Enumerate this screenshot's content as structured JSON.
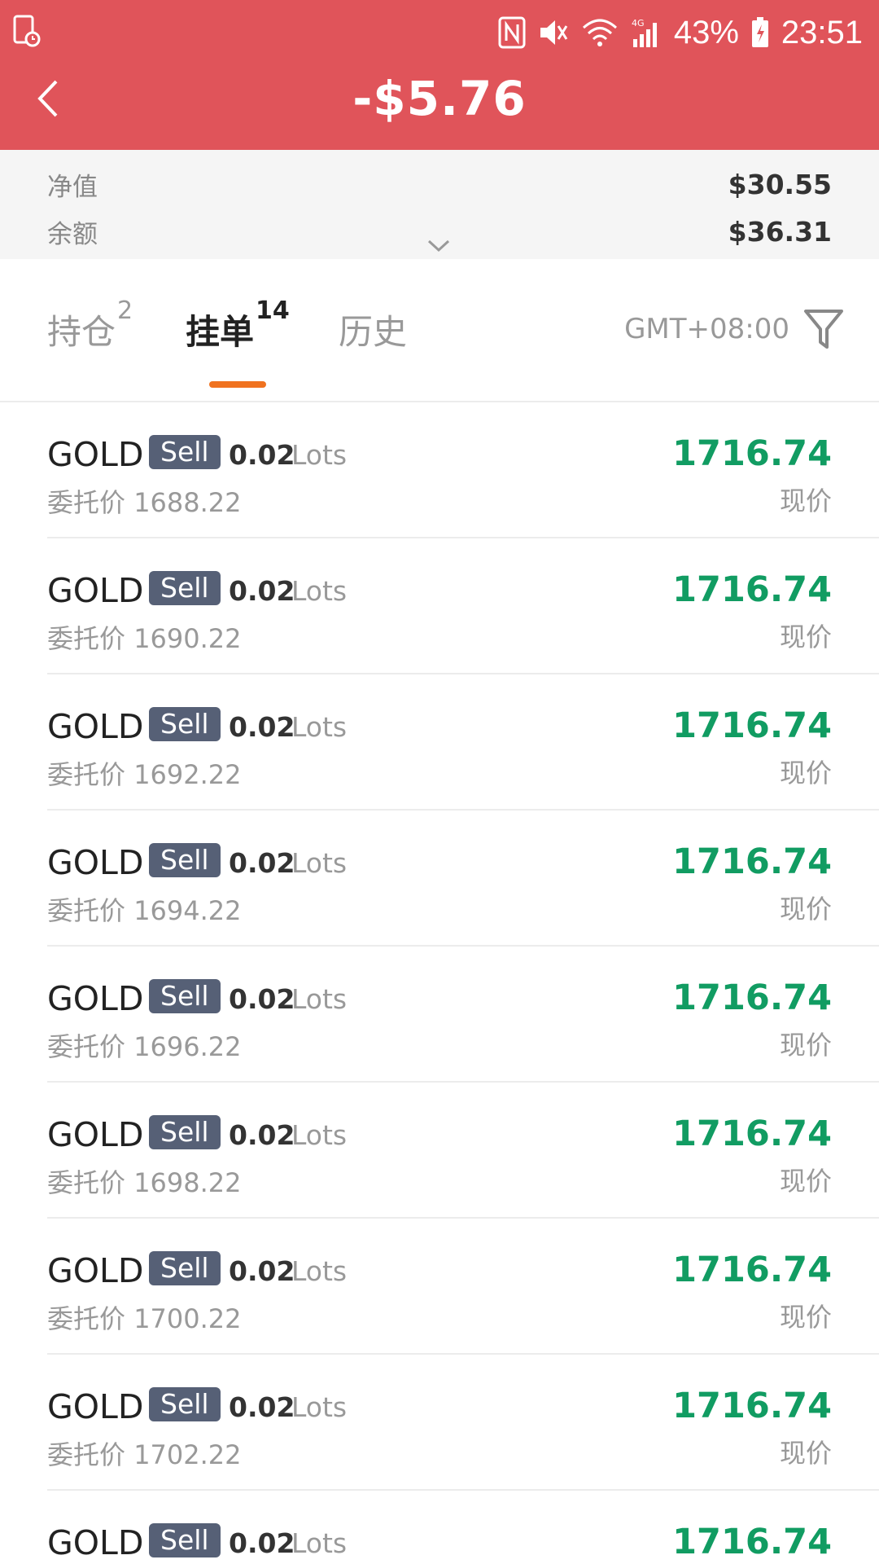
{
  "status_bar": {
    "battery": "43%",
    "time": "23:51",
    "icons": [
      "screen-record-icon",
      "nfc-icon",
      "mute-icon",
      "wifi-icon",
      "signal-4g-icon",
      "battery-icon"
    ]
  },
  "header": {
    "title": "-$5.76",
    "background": "#e0545a",
    "back_icon": "chevron-left-icon"
  },
  "summary": {
    "net_value_label": "净值",
    "net_value": "$30.55",
    "balance_label": "余额",
    "balance": "$36.31"
  },
  "tabs": [
    {
      "label": "持仓",
      "count": "2",
      "active": false
    },
    {
      "label": "挂单",
      "count": "14",
      "active": true
    },
    {
      "label": "历史",
      "count": "",
      "active": false
    }
  ],
  "timezone": "GMT+08:00",
  "orders": [
    {
      "symbol": "GOLD",
      "side": "Sell",
      "lots": "0.02",
      "lots_unit": "Lots",
      "order_label": "委托价",
      "order_price": "1688.22",
      "current_price": "1716.74",
      "current_label": "现价"
    },
    {
      "symbol": "GOLD",
      "side": "Sell",
      "lots": "0.02",
      "lots_unit": "Lots",
      "order_label": "委托价",
      "order_price": "1690.22",
      "current_price": "1716.74",
      "current_label": "现价"
    },
    {
      "symbol": "GOLD",
      "side": "Sell",
      "lots": "0.02",
      "lots_unit": "Lots",
      "order_label": "委托价",
      "order_price": "1692.22",
      "current_price": "1716.74",
      "current_label": "现价"
    },
    {
      "symbol": "GOLD",
      "side": "Sell",
      "lots": "0.02",
      "lots_unit": "Lots",
      "order_label": "委托价",
      "order_price": "1694.22",
      "current_price": "1716.74",
      "current_label": "现价"
    },
    {
      "symbol": "GOLD",
      "side": "Sell",
      "lots": "0.02",
      "lots_unit": "Lots",
      "order_label": "委托价",
      "order_price": "1696.22",
      "current_price": "1716.74",
      "current_label": "现价"
    },
    {
      "symbol": "GOLD",
      "side": "Sell",
      "lots": "0.02",
      "lots_unit": "Lots",
      "order_label": "委托价",
      "order_price": "1698.22",
      "current_price": "1716.74",
      "current_label": "现价"
    },
    {
      "symbol": "GOLD",
      "side": "Sell",
      "lots": "0.02",
      "lots_unit": "Lots",
      "order_label": "委托价",
      "order_price": "1700.22",
      "current_price": "1716.74",
      "current_label": "现价"
    },
    {
      "symbol": "GOLD",
      "side": "Sell",
      "lots": "0.02",
      "lots_unit": "Lots",
      "order_label": "委托价",
      "order_price": "1702.22",
      "current_price": "1716.74",
      "current_label": "现价"
    },
    {
      "symbol": "GOLD",
      "side": "Sell",
      "lots": "0.02",
      "lots_unit": "Lots",
      "order_label": "",
      "order_price": "",
      "current_price": "1716.74",
      "current_label": ""
    }
  ],
  "colors": {
    "header_red": "#e0545a",
    "price_green": "#119c62",
    "sell_badge": "#566076",
    "tab_underline": "#f0721f"
  }
}
